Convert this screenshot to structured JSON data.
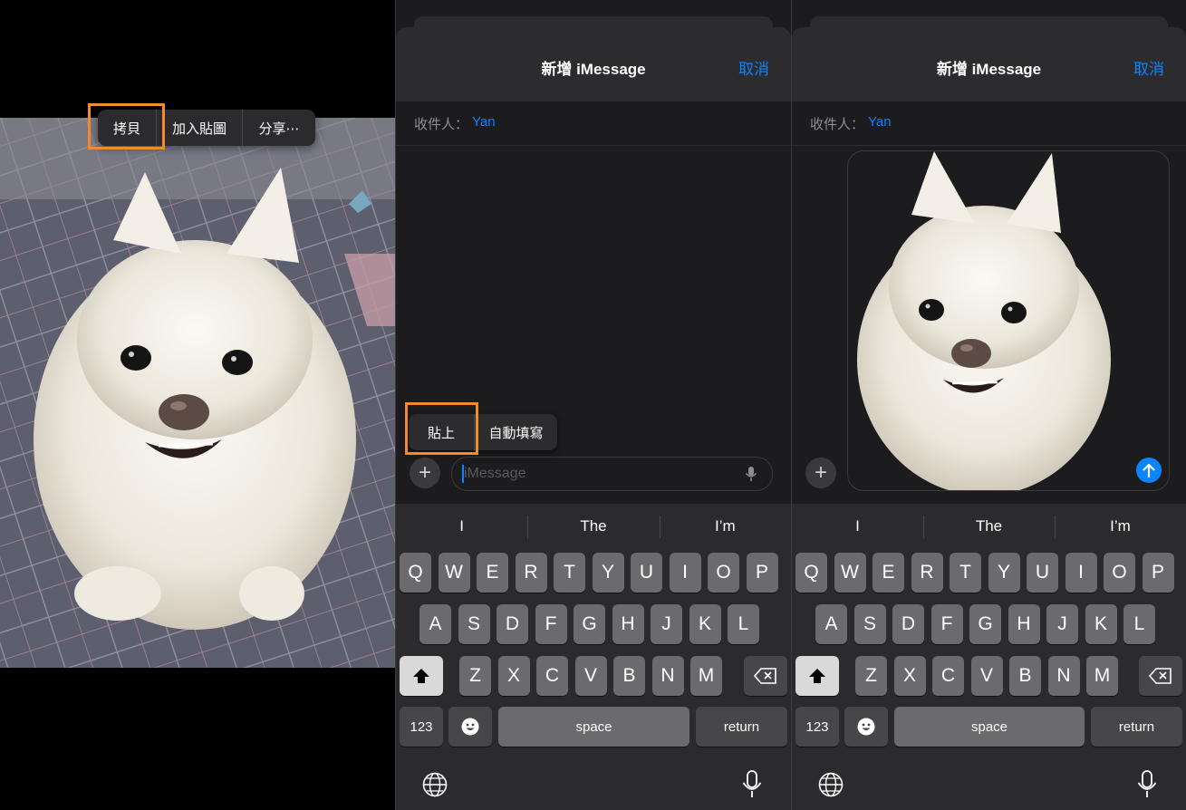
{
  "panel1": {
    "menu": {
      "copy": "拷貝",
      "add_sticker": "加入貼圖",
      "share": "分享⋯"
    }
  },
  "sheet": {
    "title": "新增 iMessage",
    "cancel": "取消",
    "to_label": "收件人：",
    "to_name": "Yan",
    "input_placeholder": "iMessage",
    "paste_menu": {
      "paste": "貼上",
      "autofill": "自動填寫"
    }
  },
  "keyboard": {
    "predictions": [
      "I",
      "The",
      "I’m"
    ],
    "row1": [
      "Q",
      "W",
      "E",
      "R",
      "T",
      "Y",
      "U",
      "I",
      "O",
      "P"
    ],
    "row2": [
      "A",
      "S",
      "D",
      "F",
      "G",
      "H",
      "J",
      "K",
      "L"
    ],
    "row3": [
      "Z",
      "X",
      "C",
      "V",
      "B",
      "N",
      "M"
    ],
    "numbers": "123",
    "space": "space",
    "return": "return"
  },
  "colors": {
    "accent": "#0a84ff",
    "highlight": "#f28a2e"
  },
  "icons": [
    "plus-icon",
    "microphone-icon",
    "send-arrow-icon",
    "shift-icon",
    "delete-icon",
    "emoji-icon",
    "globe-icon"
  ]
}
